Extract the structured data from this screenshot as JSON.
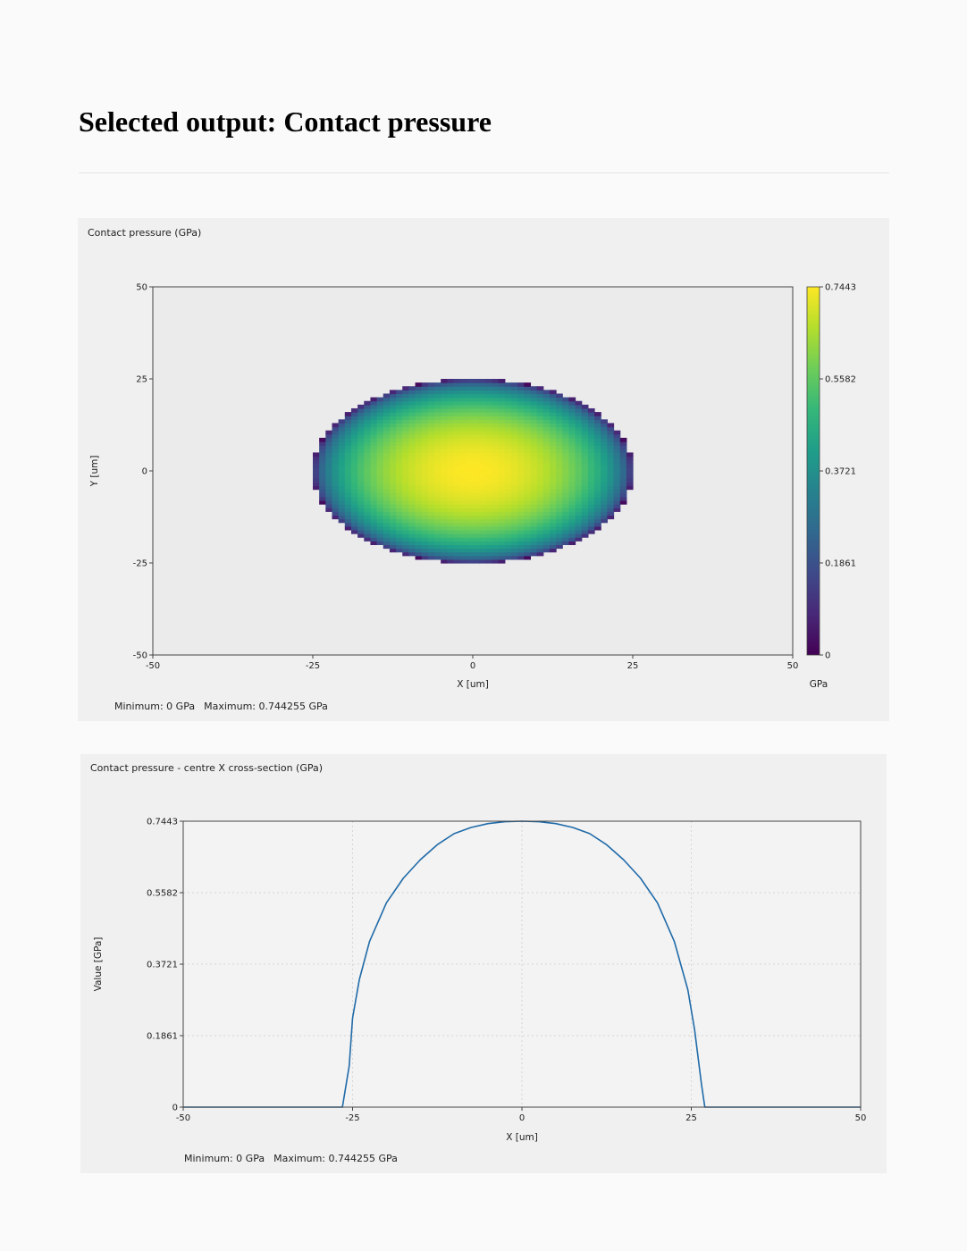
{
  "page": {
    "title": "Selected output: Contact pressure"
  },
  "chart_data": [
    {
      "type": "heatmap",
      "title": "Contact pressure (GPa)",
      "xlabel": "X [um]",
      "ylabel": "Y [um]",
      "xlim": [
        -50,
        50
      ],
      "ylim": [
        -50,
        50
      ],
      "xticks": [
        "-50",
        "-25",
        "0",
        "25",
        "50"
      ],
      "yticks": [
        "50",
        "25",
        "0",
        "-25",
        "-50"
      ],
      "contact_region": {
        "shape": "ellipse",
        "center": [
          0,
          0
        ],
        "semi_axis_x": 25,
        "semi_axis_y": 25,
        "peak_value": 0.744255
      },
      "colorbar": {
        "colormap": "viridis",
        "ticks": [
          "0.7443",
          "0.5582",
          "0.3721",
          "0.1861",
          "0"
        ],
        "range": [
          0,
          0.7443
        ],
        "unit": "GPa"
      },
      "outside_color": "#ebebeb",
      "stats": {
        "minimum": "Minimum: 0 GPa",
        "maximum": "Maximum: 0.744255 GPa"
      }
    },
    {
      "type": "line",
      "title": "Contact pressure - centre X cross-section (GPa)",
      "xlabel": "X [um]",
      "ylabel": "Value [GPa]",
      "xlim": [
        -50,
        50
      ],
      "ylim": [
        0,
        0.7443
      ],
      "xticks": [
        "-50",
        "-25",
        "0",
        "25",
        "50"
      ],
      "yticks": [
        "0.7443",
        "0.5582",
        "0.3721",
        "0.1861",
        "0"
      ],
      "grid": true,
      "color": "#1f6aa8",
      "series": [
        {
          "x": [
            -50,
            -26.5,
            -25.5,
            -25.0,
            -24.0,
            -22.5,
            -20.0,
            -17.5,
            -15.0,
            -12.5,
            -10.0,
            -7.5,
            -5.0,
            -2.5,
            0,
            2.5,
            5.0,
            7.5,
            10.0,
            12.5,
            15.0,
            17.5,
            20.0,
            22.5,
            24.5,
            25.5,
            26.5,
            27.0,
            50
          ],
          "y": [
            0,
            0,
            0.107,
            0.232,
            0.332,
            0.431,
            0.532,
            0.596,
            0.644,
            0.683,
            0.712,
            0.728,
            0.738,
            0.743,
            0.7443,
            0.743,
            0.738,
            0.728,
            0.712,
            0.683,
            0.644,
            0.596,
            0.532,
            0.431,
            0.305,
            0.2,
            0.06,
            0,
            0
          ]
        }
      ],
      "stats": {
        "minimum": "Minimum: 0 GPa",
        "maximum": "Maximum: 0.744255 GPa"
      }
    }
  ]
}
